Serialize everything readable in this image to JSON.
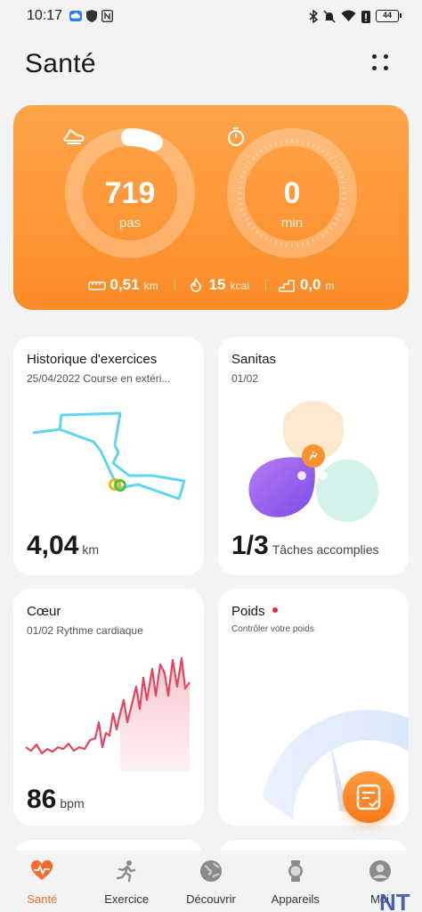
{
  "status_bar": {
    "time": "10:17",
    "battery": "44"
  },
  "header": {
    "title": "Santé"
  },
  "activity": {
    "steps_value": "719",
    "steps_unit": "pas",
    "steps_progress": 0.07,
    "minutes_value": "0",
    "minutes_unit": "min",
    "distance_value": "0,51",
    "distance_unit": "km",
    "calories_value": "15",
    "calories_unit": "kcal",
    "floors_value": "0,0",
    "floors_unit": "m"
  },
  "cards": {
    "exercise": {
      "title": "Historique d'exercices",
      "subtitle": "25/04/2022  Course en extéri...",
      "value": "4,04",
      "unit": "km"
    },
    "sanitas": {
      "title": "Sanitas",
      "subtitle": "01/02",
      "value": "1/3",
      "unit": "Tâches accomplies"
    },
    "heart": {
      "title": "Cœur",
      "subtitle": "01/02  Rythme cardiaque",
      "value": "86",
      "unit": "bpm"
    },
    "weight": {
      "title": "Poids",
      "subtitle": "Contrôler votre poids"
    }
  },
  "nav": {
    "items": [
      {
        "label": "Santé"
      },
      {
        "label": "Exercice"
      },
      {
        "label": "Découvrir"
      },
      {
        "label": "Appareils"
      },
      {
        "label": "Moi"
      }
    ]
  },
  "colors": {
    "accent": "#fb8c27",
    "active_nav": "#fb6a2c",
    "heart_line": "#e2465f",
    "route": "#5fd6ec"
  },
  "watermark": "NT"
}
